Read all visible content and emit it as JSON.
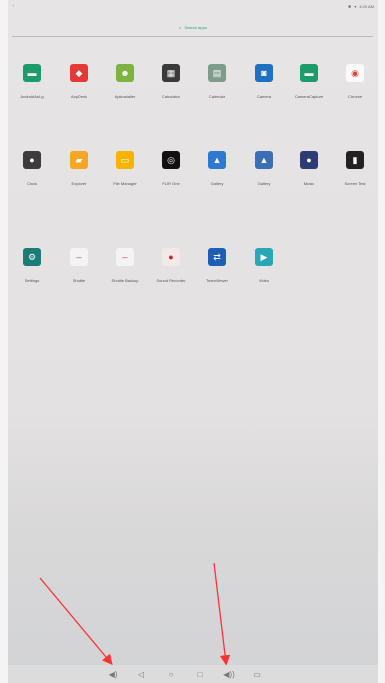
{
  "status": {
    "left_text": "↑",
    "right_text": "4:20 AM",
    "wifi_icon": "wifi-icon",
    "bt_icon": "bluetooth-icon"
  },
  "search": {
    "label": "Search apps"
  },
  "apps": [
    {
      "name": "AndroidAnLg",
      "icon": "android-icon",
      "color": "#1e9b6b"
    },
    {
      "name": "AnyDesk",
      "icon": "anydesk-icon",
      "color": "#e53935"
    },
    {
      "name": "Apkinstaller",
      "icon": "android-bot-icon",
      "color": "#7cb342"
    },
    {
      "name": "Calculator",
      "icon": "calculator-icon",
      "color": "#3a3a3a"
    },
    {
      "name": "Calendar",
      "icon": "calendar-icon",
      "color": "#7f9c8a"
    },
    {
      "name": "Camera",
      "icon": "camera-icon",
      "color": "#1e70c1"
    },
    {
      "name": "CameraCapture",
      "icon": "android-icon",
      "color": "#1e9b6b"
    },
    {
      "name": "Chrome",
      "icon": "chrome-icon",
      "color": "#fafafa"
    },
    {
      "name": "Clock",
      "icon": "clock-icon",
      "color": "#3c3c3c"
    },
    {
      "name": "Explorer",
      "icon": "folder-icon",
      "color": "#f5a623"
    },
    {
      "name": "File Manager",
      "icon": "file-manager-icon",
      "color": "#f5b400"
    },
    {
      "name": "FLIR One",
      "icon": "flir-icon",
      "color": "#111111"
    },
    {
      "name": "Gallery",
      "icon": "gallery-icon",
      "color": "#2e7ad3"
    },
    {
      "name": "Gallery",
      "icon": "gallery-photo-icon",
      "color": "#3d6fb6"
    },
    {
      "name": "Music",
      "icon": "music-icon",
      "color": "#2e3b75"
    },
    {
      "name": "Screen Test",
      "icon": "screen-test-icon",
      "color": "#222222"
    },
    {
      "name": "Settings",
      "icon": "settings-gear-icon",
      "color": "#1b7b75"
    },
    {
      "name": "Shuttle",
      "icon": "shuttle-icon",
      "color": "#f4f4f4"
    },
    {
      "name": "Shuttle Backup",
      "icon": "shuttle-backup-icon",
      "color": "#f4f4f4"
    },
    {
      "name": "Sound Recorder",
      "icon": "microphone-icon",
      "color": "#f3e9e9"
    },
    {
      "name": "TeamViewer",
      "icon": "teamviewer-icon",
      "color": "#1e5fb5"
    },
    {
      "name": "Video",
      "icon": "video-play-icon",
      "color": "#2aa7b5"
    }
  ],
  "nav": {
    "volume_down": "volume-down-icon",
    "back": "back-icon",
    "home": "home-icon",
    "recents": "recents-icon",
    "volume_up": "volume-up-icon",
    "screenshot": "screenshot-icon"
  },
  "annotation_color": "#ff3333"
}
